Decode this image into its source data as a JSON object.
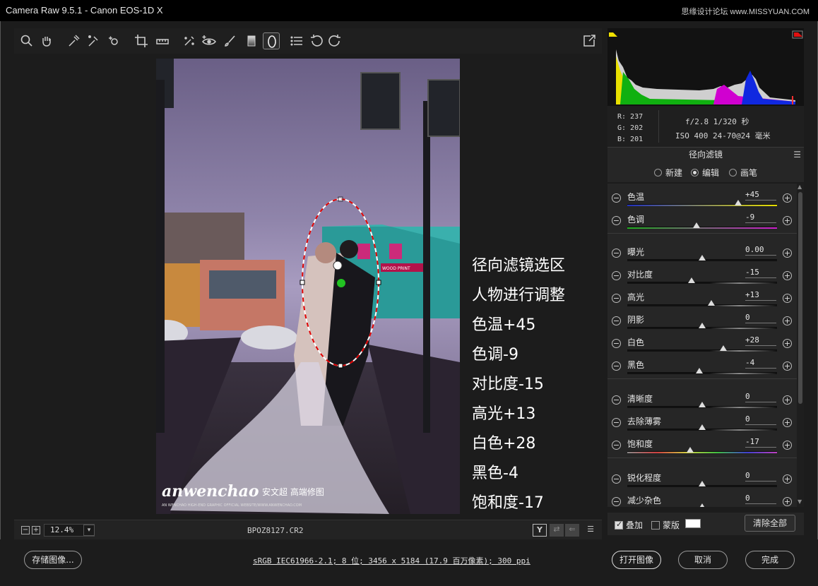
{
  "window": {
    "title": "Camera Raw 9.5.1  -  Canon EOS-1D X",
    "watermark": "思缘设计论坛 www.MISSYUAN.COM"
  },
  "toolbar": {
    "tools": [
      "zoom-icon",
      "hand-icon",
      "white-balance-icon",
      "color-sampler-icon",
      "targeted-adjust-icon",
      "crop-icon",
      "straighten-icon",
      "spot-removal-icon",
      "red-eye-icon",
      "adjustment-brush-icon",
      "graduated-filter-icon",
      "radial-filter-icon",
      "presets-list-icon",
      "rotate-left-icon",
      "rotate-right-icon"
    ],
    "export_icon": "open-preferences-icon"
  },
  "canvas": {
    "overlay_lines": [
      "径向滤镜选区",
      "人物进行调整",
      "色温+45",
      "色调-9",
      "对比度-15",
      "高光+13",
      "白色+28",
      "黑色-4",
      "饱和度-17"
    ],
    "photo_watermark": "anwenchao",
    "photo_watermark_cn": "安文超 高端修图",
    "photo_watermark_sub": "AN WENCHAO HIGH-END GRAPHIC OFFICIAL WEBSITE/WWW.ANWENCHAO.COM",
    "sign": "WOOD PRINT"
  },
  "status": {
    "zoom": "12.4%",
    "filename": "BPOZ8127.CR2"
  },
  "info": {
    "r": "R:  237",
    "g": "G:  202",
    "b": "B:  201",
    "exif1": "f/2.8  1/320 秒",
    "exif2": "ISO 400  24-70@24 毫米"
  },
  "panel": {
    "title": "径向滤镜",
    "modes": [
      "新建",
      "编辑",
      "画笔"
    ],
    "selected_mode": "编辑"
  },
  "sliders": [
    {
      "label": "色温",
      "value": "+45",
      "pos": 0.74,
      "track": "temp"
    },
    {
      "label": "色调",
      "value": "-9",
      "pos": 0.46,
      "track": "tint"
    },
    {
      "label": "曝光",
      "value": "0.00",
      "pos": 0.5,
      "track": "plain"
    },
    {
      "label": "对比度",
      "value": "-15",
      "pos": 0.43,
      "track": "grad"
    },
    {
      "label": "高光",
      "value": "+13",
      "pos": 0.56,
      "track": "grad"
    },
    {
      "label": "阴影",
      "value": "0",
      "pos": 0.5,
      "track": "grad"
    },
    {
      "label": "白色",
      "value": "+28",
      "pos": 0.64,
      "track": "grad"
    },
    {
      "label": "黑色",
      "value": "-4",
      "pos": 0.48,
      "track": "grad"
    },
    {
      "label": "清晰度",
      "value": "0",
      "pos": 0.5,
      "track": "grad"
    },
    {
      "label": "去除薄雾",
      "value": "0",
      "pos": 0.5,
      "track": "grad"
    },
    {
      "label": "饱和度",
      "value": "-17",
      "pos": 0.42,
      "track": "sat"
    },
    {
      "label": "锐化程度",
      "value": "0",
      "pos": 0.5,
      "track": "plain"
    },
    {
      "label": "减少杂色",
      "value": "0",
      "pos": 0.5,
      "track": "plain"
    }
  ],
  "bottom_opts": {
    "overlay": "叠加",
    "mask": "蒙版",
    "clear_all": "清除全部"
  },
  "footer": {
    "save": "存储图像...",
    "color_info": "sRGB IEC61966-2.1; 8 位; 3456 x 5184 (17.9 百万像素); 300 ppi",
    "open": "打开图像",
    "cancel": "取消",
    "done": "完成"
  }
}
